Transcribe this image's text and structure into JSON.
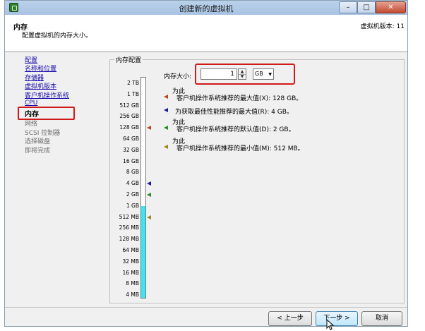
{
  "window": {
    "title": "创建新的虚拟机",
    "buttons": {
      "minimize": "–",
      "maximize": "□",
      "close": "✕"
    }
  },
  "header": {
    "title": "内存",
    "description": "配置虚拟机的内存大小。",
    "version": "虚拟机版本: 11"
  },
  "nav": {
    "items": [
      {
        "label": "配置",
        "state": "link"
      },
      {
        "label": "名称和位置",
        "state": "link"
      },
      {
        "label": "存储器",
        "state": "link"
      },
      {
        "label": "虚拟机版本",
        "state": "link"
      },
      {
        "label": "客户机操作系统",
        "state": "link"
      },
      {
        "label": "CPU",
        "state": "link"
      },
      {
        "label": "内存",
        "state": "current"
      },
      {
        "label": "网络",
        "state": "disabled"
      },
      {
        "label": "SCSI 控制器",
        "state": "disabled"
      },
      {
        "label": "选择磁盘",
        "state": "disabled"
      },
      {
        "label": "即将完成",
        "state": "disabled"
      }
    ]
  },
  "memory": {
    "group_label": "内存配置",
    "size_label": "内存大小:",
    "size_value": "1",
    "unit": "GB",
    "scale": [
      "2 TB",
      "1 TB",
      "512 GB",
      "256 GB",
      "128 GB",
      "64 GB",
      "32 GB",
      "16 GB",
      "8 GB",
      "4 GB",
      "2 GB",
      "1 GB",
      "512 MB",
      "256 MB",
      "128 MB",
      "64 MB",
      "32 MB",
      "16 MB",
      "8 MB",
      "4 MB"
    ],
    "legend": [
      {
        "prefix": "为此",
        "text": "客户机操作系统推荐的最大值(X): 128 GB。",
        "color": "#b04a1e"
      },
      {
        "prefix": "",
        "text": "为获取最佳性能推荐的最大值(R): 4 GB。",
        "color": "#1a1a9a"
      },
      {
        "prefix": "为此",
        "text": "客户机操作系统推荐的默认值(D): 2 GB。",
        "color": "#2a8a2a"
      },
      {
        "prefix": "为此",
        "text": "客户机操作系统推荐的最小值(M): 512 MB。",
        "color": "#9a8a1a"
      }
    ]
  },
  "footer": {
    "back": "< 上一步",
    "next": "下一步 >",
    "cancel": "取消"
  }
}
